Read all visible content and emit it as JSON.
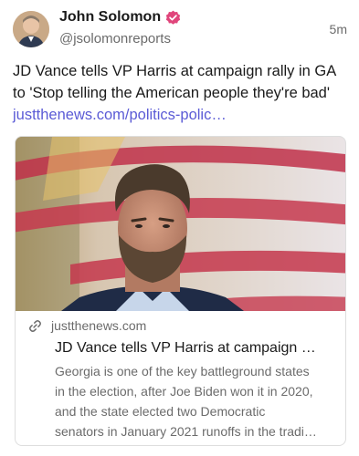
{
  "author": {
    "display_name": "John Solomon",
    "handle": "@jsolomonreports",
    "avatar_icon": "avatar-photo",
    "verified_icon": "verified-badge-icon",
    "verified_color": "#e0457b"
  },
  "post": {
    "timestamp": "5m",
    "text": "JD Vance tells VP Harris at campaign rally in GA to 'Stop telling the American people they're bad'",
    "link_text": "justthenews.com/politics-polic…",
    "link_color": "#5b5bd6"
  },
  "link_card": {
    "image_icon": "news-photo",
    "link_icon": "link-icon",
    "domain": "justthenews.com",
    "title": "JD Vance tells VP Harris at campaign …",
    "description_lines": [
      "Georgia is one of the key battleground states",
      "in the election, after Joe Biden won it in 2020,",
      "and the state elected two Democratic",
      "senators in January 2021 runoffs in the tradi…"
    ]
  }
}
